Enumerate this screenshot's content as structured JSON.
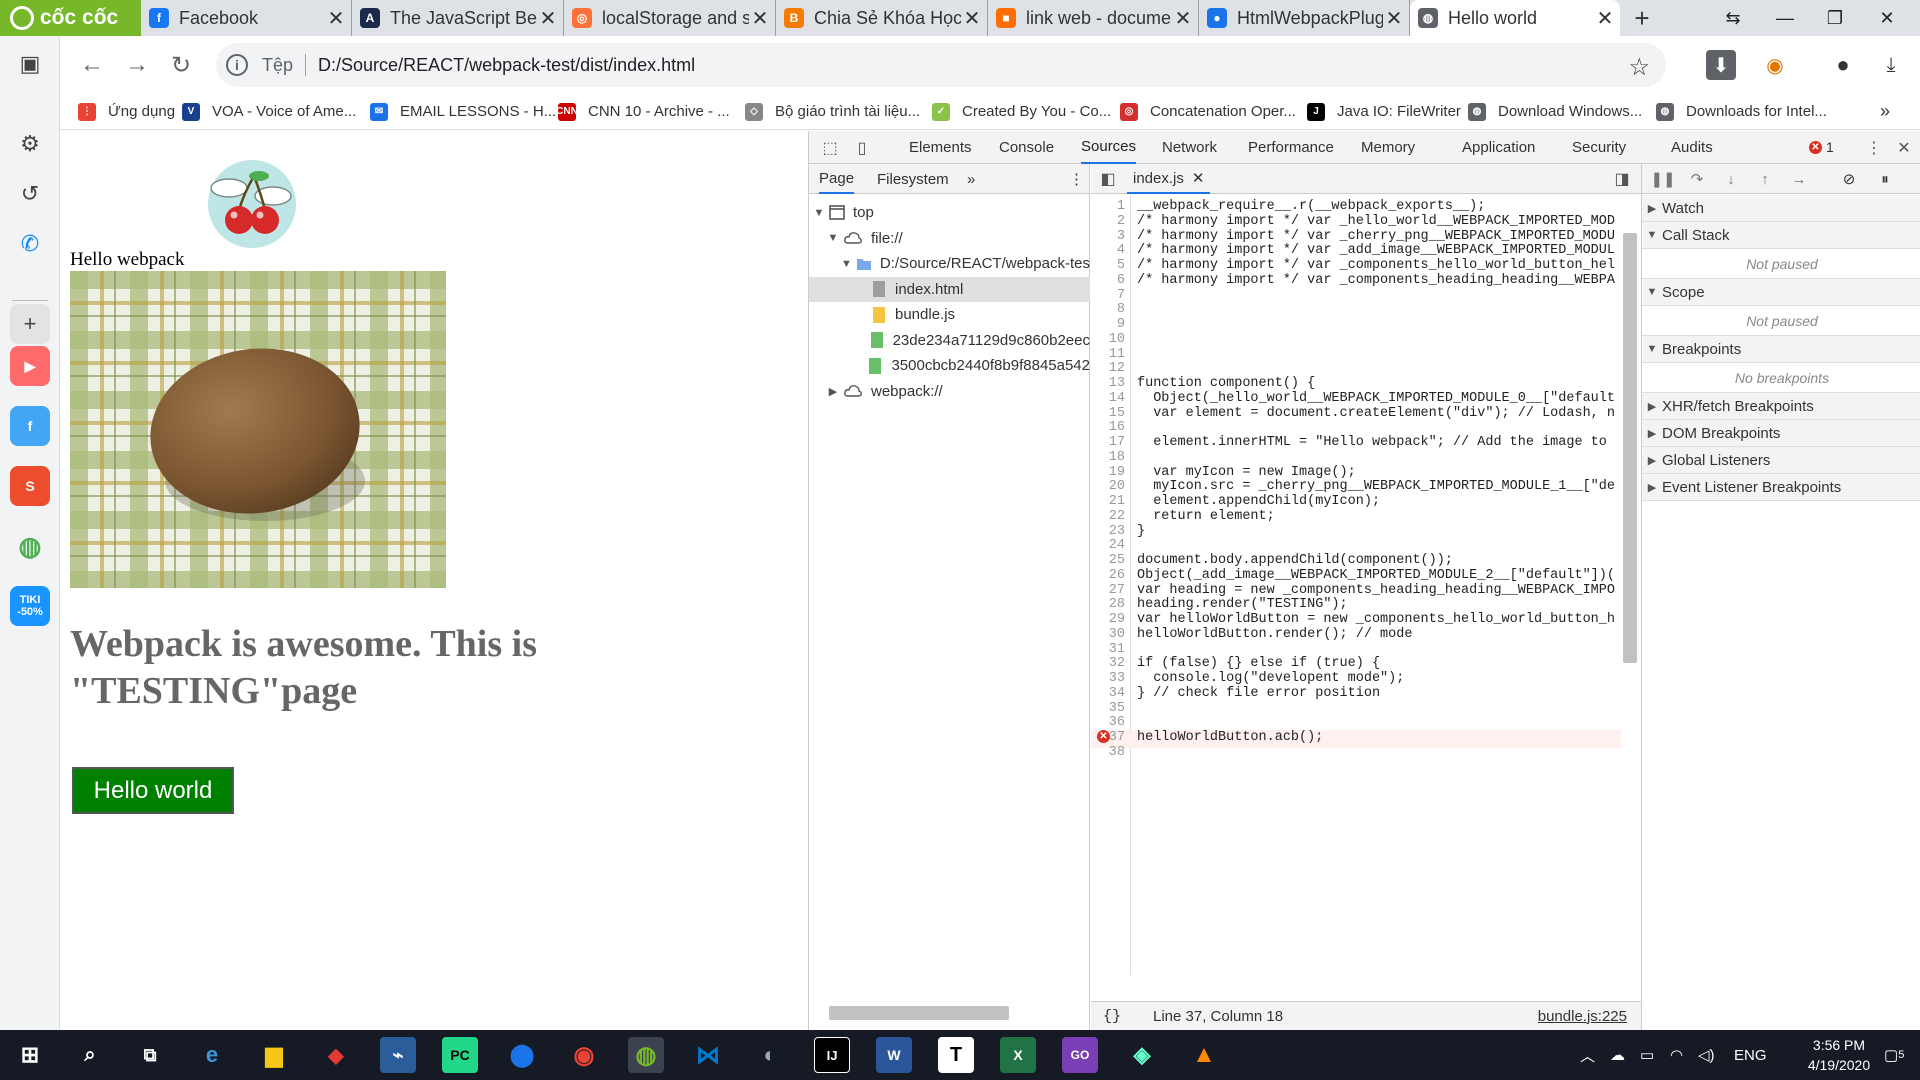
{
  "browser": {
    "brand": "cốc cốc",
    "tabs": [
      {
        "label": "Facebook",
        "color": "#1877f2",
        "glyph": "f"
      },
      {
        "label": "The JavaScript Beg",
        "color": "#1b2a4a",
        "glyph": "A"
      },
      {
        "label": "localStorage and s",
        "color": "#ff7139",
        "glyph": "◎"
      },
      {
        "label": "Chia Sẻ Khóa Học",
        "color": "#f57c00",
        "glyph": "B"
      },
      {
        "label": "link web - docume",
        "color": "#ff6d00",
        "glyph": "■"
      },
      {
        "label": "HtmlWebpackPlug",
        "color": "#1a73e8",
        "glyph": "●"
      },
      {
        "label": "Hello world",
        "color": "#5f6368",
        "glyph": "◍"
      }
    ],
    "address": {
      "scheme": "Tệp",
      "url": "D:/Source/REACT/webpack-test/dist/index.html"
    },
    "bookmarks": [
      {
        "label": "Ứng dụng",
        "color": "#ea4335",
        "glyph": "⋮"
      },
      {
        "label": "VOA - Voice of Ame...",
        "color": "#1a3f8f",
        "glyph": "V"
      },
      {
        "label": "EMAIL LESSONS - H...",
        "color": "#1a73e8",
        "glyph": "✉"
      },
      {
        "label": "CNN 10 - Archive - ...",
        "color": "#cc0000",
        "glyph": "CNN"
      },
      {
        "label": "Bộ giáo trình tài liệu...",
        "color": "#888888",
        "glyph": "◇"
      },
      {
        "label": "Created By You - Co...",
        "color": "#8bc34a",
        "glyph": "✓"
      },
      {
        "label": "Concatenation Oper...",
        "color": "#d32f2f",
        "glyph": "◎"
      },
      {
        "label": "Java IO: FileWriter",
        "color": "#000000",
        "glyph": "J"
      },
      {
        "label": "Download Windows...",
        "color": "#5f6368",
        "glyph": "◍"
      },
      {
        "label": "Downloads for Intel...",
        "color": "#5f6368",
        "glyph": "◍"
      }
    ]
  },
  "page": {
    "hello_text": "Hello webpack",
    "heading": "Webpack is awesome. This is \"TESTING\"page",
    "button_label": "Hello world"
  },
  "devtools": {
    "tabs": [
      "Elements",
      "Console",
      "Sources",
      "Network",
      "Performance",
      "Memory",
      "Application",
      "Security",
      "Audits"
    ],
    "active_tab": "Sources",
    "error_count": "1",
    "navigator": {
      "tabs": [
        "Page",
        "Filesystem"
      ],
      "tree": [
        {
          "label": "top",
          "indent": 0,
          "tri": "▼",
          "icon": "frame"
        },
        {
          "label": "file://",
          "indent": 1,
          "tri": "▼",
          "icon": "cloud"
        },
        {
          "label": "D:/Source/REACT/webpack-test",
          "indent": 2,
          "tri": "▼",
          "icon": "folder"
        },
        {
          "label": "index.html",
          "indent": 3,
          "tri": "",
          "icon": "file-gray",
          "selected": true
        },
        {
          "label": "bundle.js",
          "indent": 3,
          "tri": "",
          "icon": "file-yellow"
        },
        {
          "label": "23de234a71129d9c860b2eec",
          "indent": 3,
          "tri": "",
          "icon": "file-green"
        },
        {
          "label": "3500cbcb2440f8b9f8845a542",
          "indent": 3,
          "tri": "",
          "icon": "file-green"
        },
        {
          "label": "webpack://",
          "indent": 1,
          "tri": "▶",
          "icon": "cloud"
        }
      ]
    },
    "editor": {
      "file_tab": "index.js",
      "status_position": "Line 37, Column 18",
      "status_file": "bundle.js:225",
      "lines": [
        "__webpack_require__.r(__webpack_exports__);",
        "/* harmony import */ var _hello_world__WEBPACK_IMPORTED_MOD",
        "/* harmony import */ var _cherry_png__WEBPACK_IMPORTED_MODU",
        "/* harmony import */ var _add_image__WEBPACK_IMPORTED_MODUL",
        "/* harmony import */ var _components_hello_world_button_hel",
        "/* harmony import */ var _components_heading_heading__WEBPA",
        "",
        "",
        "",
        "",
        "",
        "",
        "function component() {",
        "  Object(_hello_world__WEBPACK_IMPORTED_MODULE_0__[\"default",
        "  var element = document.createElement(\"div\"); // Lodash, n",
        "",
        "  element.innerHTML = \"Hello webpack\"; // Add the image to",
        "",
        "  var myIcon = new Image();",
        "  myIcon.src = _cherry_png__WEBPACK_IMPORTED_MODULE_1__[\"de",
        "  element.appendChild(myIcon);",
        "  return element;",
        "}",
        "",
        "document.body.appendChild(component());",
        "Object(_add_image__WEBPACK_IMPORTED_MODULE_2__[\"default\"])(",
        "var heading = new _components_heading_heading__WEBPACK_IMPO",
        "heading.render(\"TESTING\");",
        "var helloWorldButton = new _components_hello_world_button_h",
        "helloWorldButton.render(); // mode",
        "",
        "if (false) {} else if (true) {",
        "  console.log(\"developent mode\");",
        "} // check file error position",
        "",
        "",
        "helloWorldButton.acb();",
        ""
      ],
      "error_line": 37
    },
    "debugger": {
      "sections": [
        {
          "label": "Watch",
          "open": false,
          "body": ""
        },
        {
          "label": "Call Stack",
          "open": true,
          "body": "Not paused"
        },
        {
          "label": "Scope",
          "open": true,
          "body": "Not paused"
        },
        {
          "label": "Breakpoints",
          "open": true,
          "body": "No breakpoints"
        },
        {
          "label": "XHR/fetch Breakpoints",
          "open": false,
          "body": ""
        },
        {
          "label": "DOM Breakpoints",
          "open": false,
          "body": ""
        },
        {
          "label": "Global Listeners",
          "open": false,
          "body": ""
        },
        {
          "label": "Event Listener Breakpoints",
          "open": false,
          "body": ""
        }
      ]
    }
  },
  "taskbar": {
    "language": "ENG",
    "time": "3:56 PM",
    "date": "4/19/2020",
    "notifications": "5"
  },
  "colors": {
    "brand_green": "#76b82a",
    "button_green": "#008000",
    "devtools_accent": "#1a73e8",
    "error_red": "#d93025"
  }
}
